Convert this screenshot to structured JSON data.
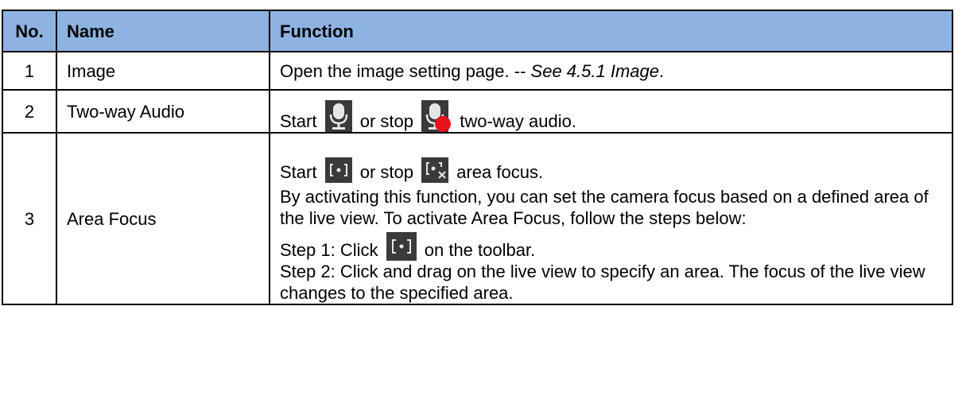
{
  "table": {
    "headers": {
      "no": "No.",
      "name": "Name",
      "function": "Function"
    },
    "rows": [
      {
        "no": "1",
        "name": "Image",
        "func_text": "Open the image setting page.   -- ",
        "func_see": "See 4.5.1 Image",
        "func_end": "."
      },
      {
        "no": "2",
        "name": "Two-way Audio",
        "start": "Start",
        "or_stop": "or stop",
        "end": "two-way audio.",
        "icons": [
          "microphone-icon",
          "microphone-off-icon"
        ]
      },
      {
        "no": "3",
        "name": "Area Focus",
        "start": "Start",
        "or_stop": "or stop",
        "end": "area focus.",
        "description": "By activating this function, you can set the camera focus based on a defined area of the live view. To activate Area Focus, follow the steps below:",
        "step1_pre": "Step 1: Click",
        "step1_post": "on the toolbar.",
        "step2": "Step 2: Click and drag on the live view to specify an area. The focus of the live view changes to the specified area.",
        "icons": [
          "area-focus-icon",
          "area-focus-off-icon"
        ]
      }
    ]
  },
  "colors": {
    "header_bg": "#8db3e2",
    "icon_bg": "#3a3a3a",
    "stop_dot": "#e8141c"
  }
}
